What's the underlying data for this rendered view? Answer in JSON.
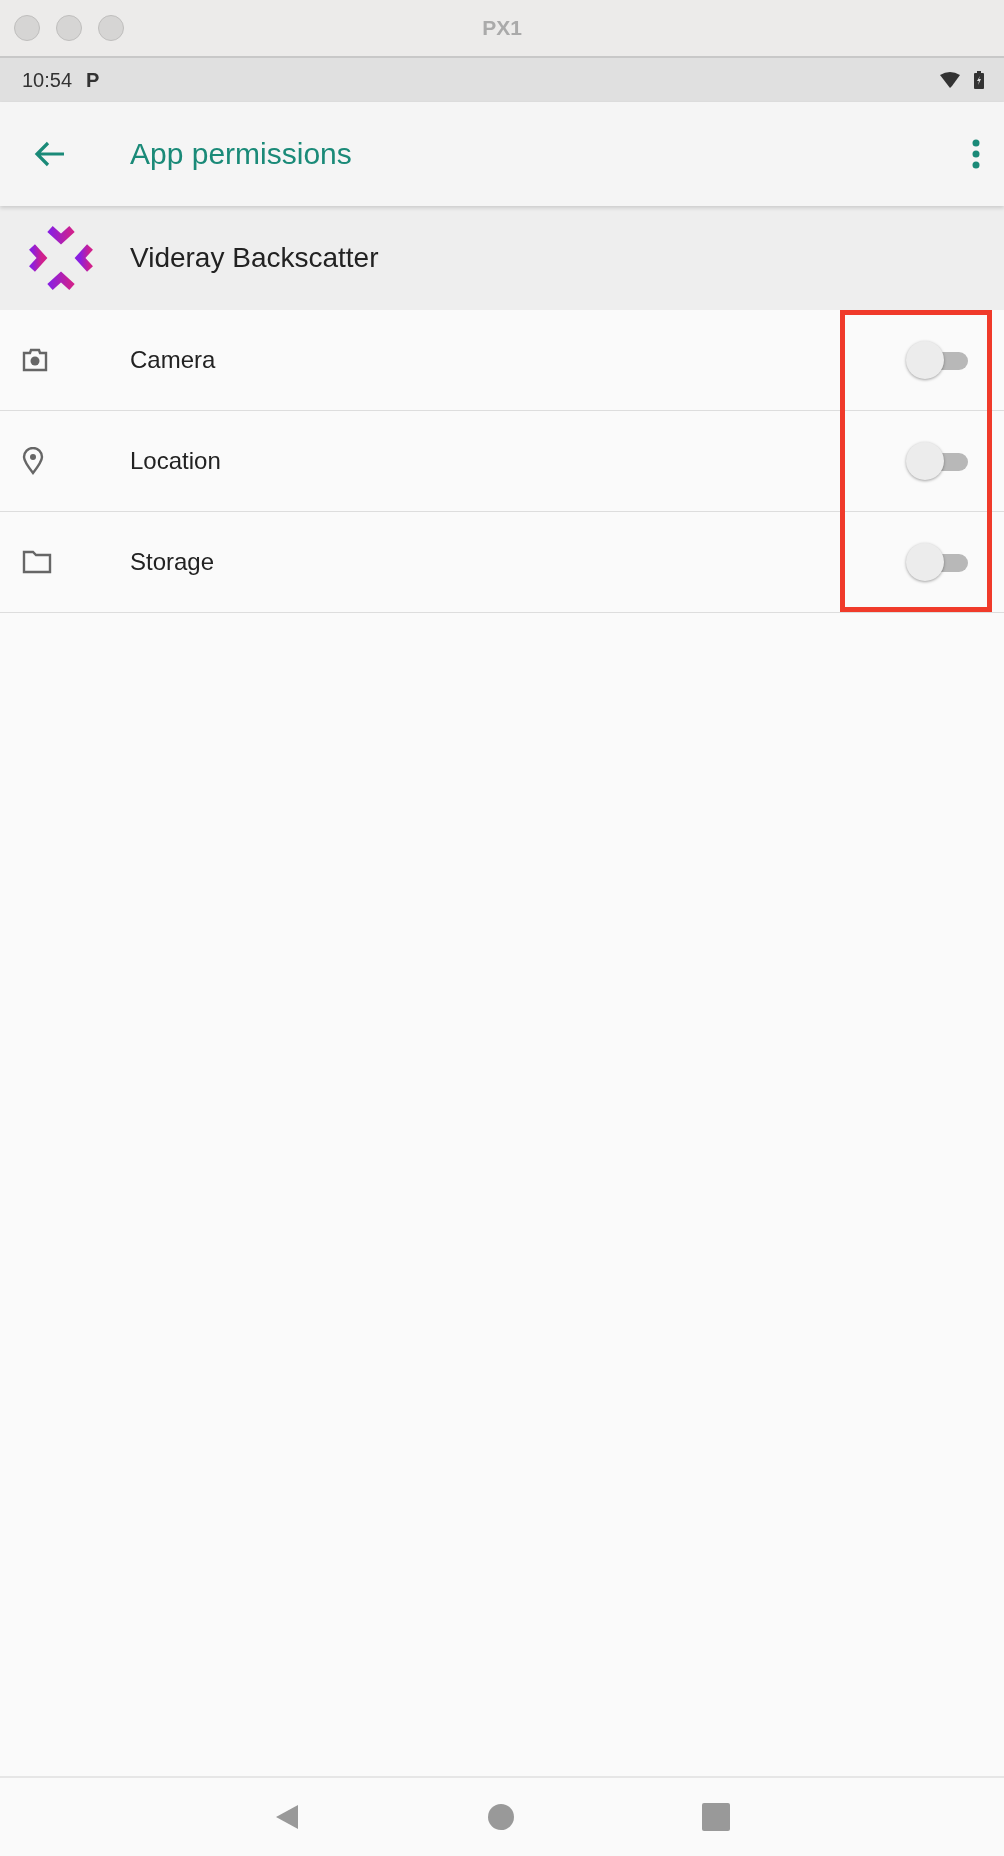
{
  "window": {
    "title": "PX1"
  },
  "status_bar": {
    "time": "10:54",
    "notification": "P"
  },
  "app_bar": {
    "title": "App permissions"
  },
  "app": {
    "name": "Videray Backscatter"
  },
  "permissions": [
    {
      "kind": "camera",
      "label": "Camera",
      "on": false
    },
    {
      "kind": "location",
      "label": "Location",
      "on": false
    },
    {
      "kind": "storage",
      "label": "Storage",
      "on": false
    }
  ]
}
